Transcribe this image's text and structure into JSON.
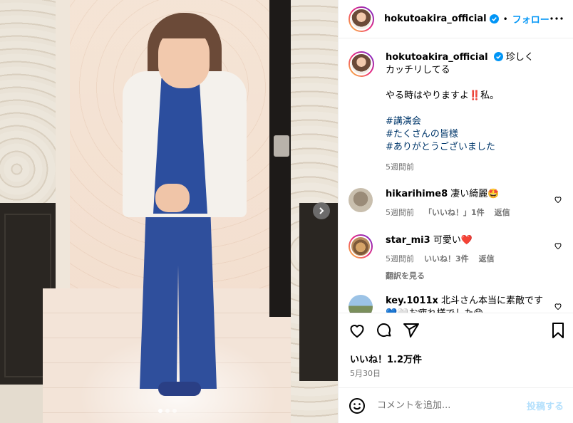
{
  "post": {
    "username": "hokutoakira_official",
    "follow_label": "フォロー",
    "caption_line1": "珍しく",
    "caption_line2": "カッチリしてる",
    "caption_line3": "やる時はやりますよ‼️私。",
    "hashtags": [
      "#講演会",
      "#たくさんの皆様",
      "#ありがとうございました"
    ],
    "caption_time": "5週間前"
  },
  "comments": [
    {
      "user": "hikarihime8",
      "text": "凄い綺麗🤩",
      "time": "5週間前",
      "likes": "「いいね！」1件",
      "reply": "返信"
    },
    {
      "user": "star_mi3",
      "text": "可愛い❤️",
      "time": "5週間前",
      "likes": "いいね！3件",
      "reply": "返信",
      "translate": "翻訳を見る"
    },
    {
      "user": "key.1011x",
      "text": "北斗さん本当に素敵です💙🤍お疲れ様でした😊"
    }
  ],
  "footer": {
    "likes": "いいね！1.2万件",
    "date": "5月30日",
    "comment_placeholder": "コメントを追加...",
    "post_label": "投稿する"
  },
  "carousel": {
    "total": 3,
    "active": 1
  },
  "colors": {
    "accent": "#0095f6",
    "verified": "#0095f6",
    "like_red": "#ed4956"
  }
}
